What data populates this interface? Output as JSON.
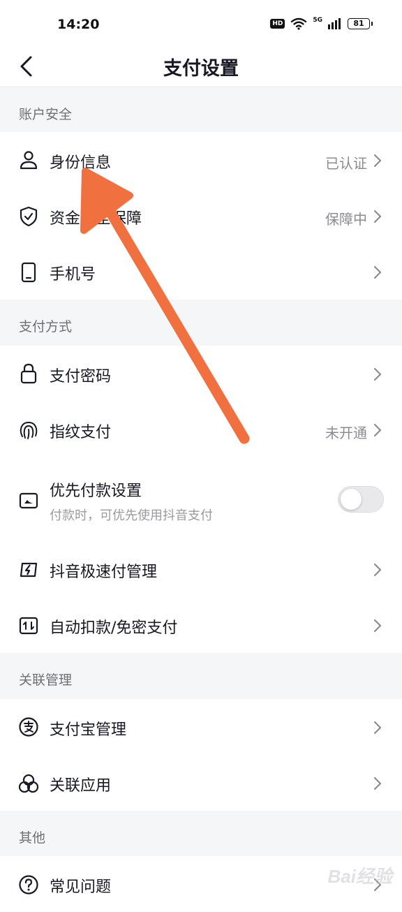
{
  "status_bar": {
    "time": "14:20",
    "hd": "HD",
    "network": "5G",
    "battery": "81"
  },
  "header": {
    "title": "支付设置"
  },
  "sections": {
    "account_security": {
      "title": "账户安全",
      "identity": {
        "label": "身份信息",
        "value": "已认证",
        "icon": "person-icon"
      },
      "fund_security": {
        "label": "资金安全保障",
        "value": "保障中",
        "icon": "shield-check-icon"
      },
      "phone": {
        "label": "手机号",
        "icon": "phone-icon"
      }
    },
    "payment_methods": {
      "title": "支付方式",
      "password": {
        "label": "支付密码",
        "icon": "lock-icon"
      },
      "fingerprint": {
        "label": "指纹支付",
        "value": "未开通",
        "icon": "fingerprint-icon"
      },
      "priority": {
        "label": "优先付款设置",
        "sub": "付款时，可优先使用抖音支付",
        "enabled": false,
        "icon": "wallet-icon"
      },
      "express": {
        "label": "抖音极速付管理",
        "icon": "lightning-icon"
      },
      "auto_debit": {
        "label": "自动扣款/免密支付",
        "icon": "auto-pay-icon"
      }
    },
    "linked": {
      "title": "关联管理",
      "alipay": {
        "label": "支付宝管理",
        "icon": "alipay-icon"
      },
      "apps": {
        "label": "关联应用",
        "icon": "linked-apps-icon"
      }
    },
    "other": {
      "title": "其他",
      "faq": {
        "label": "常见问题",
        "icon": "question-icon"
      }
    }
  },
  "annotation": {
    "color": "#f07040"
  },
  "watermark": "Bai经验"
}
